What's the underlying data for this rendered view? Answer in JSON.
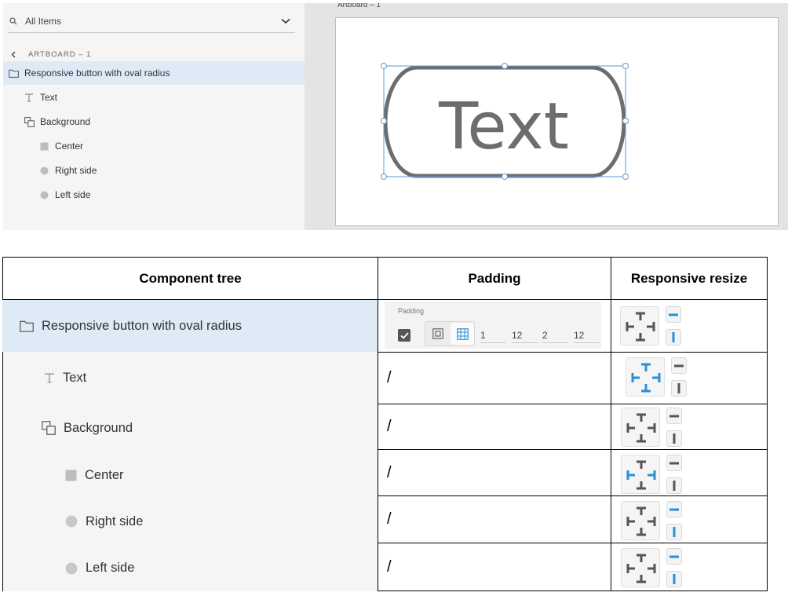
{
  "layers_panel": {
    "search_label": "All Items",
    "breadcrumb": "ARTBOARD – 1",
    "items": [
      {
        "label": "Responsive button with oval radius",
        "icon": "folder-icon"
      },
      {
        "label": "Text",
        "icon": "text-type-icon"
      },
      {
        "label": "Background",
        "icon": "group-icon"
      },
      {
        "label": "Center",
        "icon": "rectangle-icon"
      },
      {
        "label": "Right side",
        "icon": "ellipse-icon"
      },
      {
        "label": "Left side",
        "icon": "ellipse-icon"
      }
    ]
  },
  "canvas": {
    "artboard_label": "Artboard – 1",
    "button_text": "Text"
  },
  "table": {
    "headers": [
      "Component tree",
      "Padding",
      "Responsive resize"
    ],
    "rows": [
      {
        "label": "Responsive button with oval radius",
        "icon": "folder-icon",
        "padding": null,
        "resize_highlight": "constraints"
      },
      {
        "label": "Text",
        "icon": "text-type-icon",
        "padding": "/",
        "resize_highlight": "pins"
      },
      {
        "label": "Background",
        "icon": "group-icon",
        "padding": "/",
        "resize_highlight": "none"
      },
      {
        "label": "Center",
        "icon": "rectangle-icon",
        "padding": "/",
        "resize_highlight": "left-right"
      },
      {
        "label": "Right side",
        "icon": "ellipse-icon",
        "padding": "/",
        "resize_highlight": "constraints"
      },
      {
        "label": "Left side",
        "icon": "ellipse-icon",
        "padding": "/",
        "resize_highlight": "constraints"
      }
    ],
    "padding_control": {
      "label": "Padding",
      "checked": true,
      "values": [
        "1",
        "12",
        "2",
        "12"
      ]
    }
  },
  "colors": {
    "selection": "#deebf7",
    "accent_blue": "#2b8fd8",
    "selection_outline": "#5b9bd5",
    "button_stroke": "#6d6d6d"
  }
}
